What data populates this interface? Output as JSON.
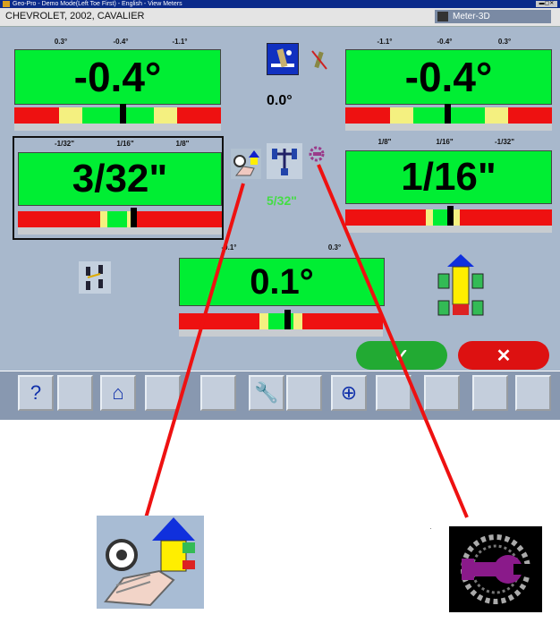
{
  "window": {
    "title": "Geo-Pro - Demo Mode(Left Toe First) - English - View Meters"
  },
  "header": {
    "vehicle": "CHEVROLET, 2002, CAVALIER",
    "mode_label": "Meter-3D"
  },
  "meters": {
    "left_camber": {
      "ticks": [
        "0.3°",
        "-0.4°",
        "-1.1°"
      ],
      "value": "-0.4°"
    },
    "right_camber": {
      "ticks": [
        "-1.1°",
        "-0.4°",
        "0.3°"
      ],
      "value": "-0.4°"
    },
    "left_toe": {
      "ticks": [
        "-1/32\"",
        "1/16\"",
        "1/8\""
      ],
      "value": "3/32\""
    },
    "right_toe": {
      "ticks": [
        "1/8\"",
        "1/16\"",
        "-1/32\""
      ],
      "value": "1/16\""
    },
    "thrust": {
      "ticks": [
        "-0.1°",
        "0.3°"
      ],
      "value": "0.1°"
    }
  },
  "center": {
    "cross_camber": "0.0°",
    "total_toe": "5/32\""
  },
  "actions": {
    "ok": "✓",
    "cancel": "✕"
  },
  "toolbar": [
    {
      "name": "help-icon",
      "glyph": "?"
    },
    {
      "name": "keyboard-icon",
      "glyph": ""
    },
    {
      "name": "home-icon",
      "glyph": "⌂"
    },
    {
      "name": "printer-icon",
      "glyph": ""
    },
    {
      "name": "spec-icon",
      "glyph": ""
    },
    {
      "name": "wrench-icon",
      "glyph": "🔧"
    },
    {
      "name": "blank-tool-icon",
      "glyph": ""
    },
    {
      "name": "zoom-icon",
      "glyph": "⊕"
    },
    {
      "name": "gauge-icon",
      "glyph": ""
    },
    {
      "name": "report-icon",
      "glyph": ""
    },
    {
      "name": "chart-icon",
      "glyph": ""
    },
    {
      "name": "exit-icon",
      "glyph": ""
    }
  ],
  "colors": {
    "readout": "#00ee33",
    "in_spec": "#00ee33",
    "warn": "#f4f080",
    "out_spec": "#ee1111",
    "callout_line": "#ee1111"
  }
}
